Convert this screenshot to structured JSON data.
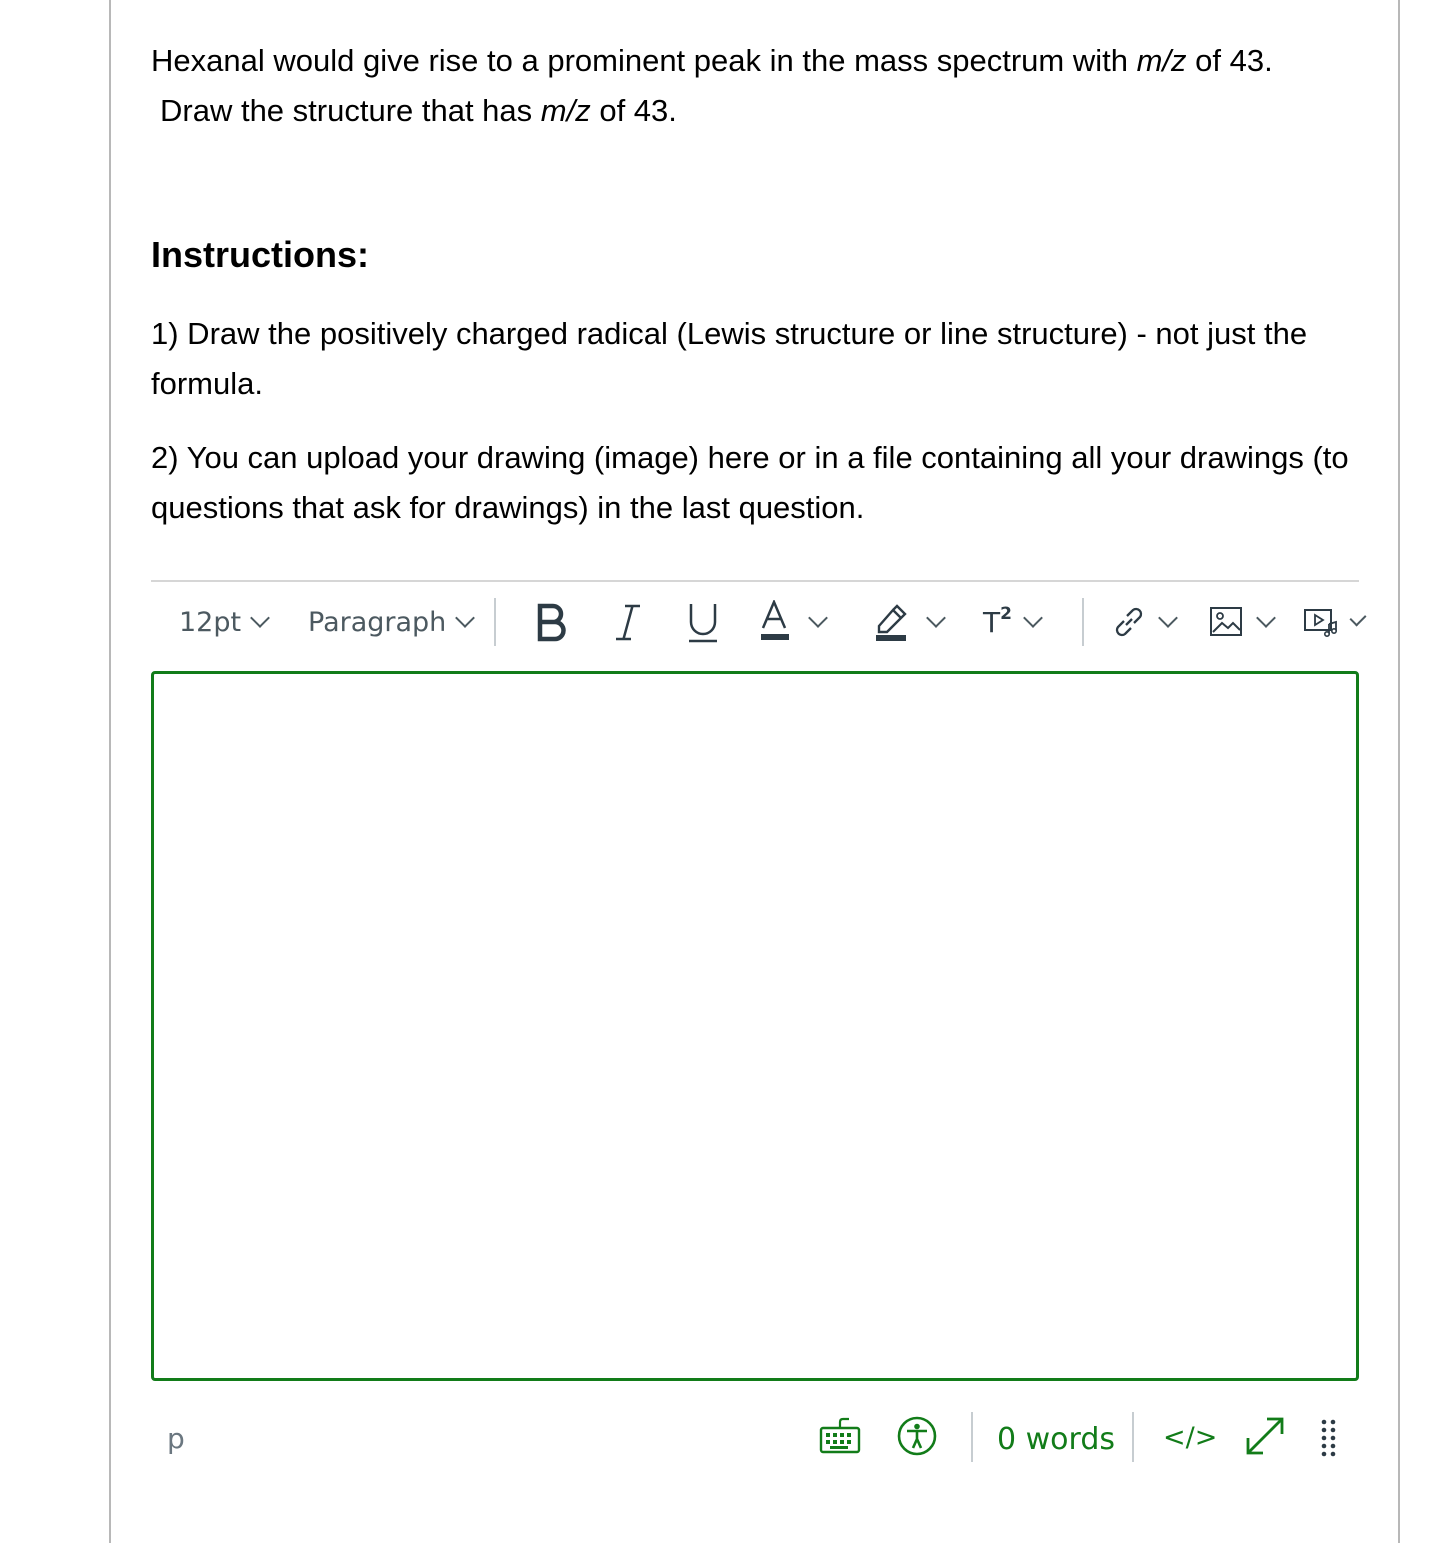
{
  "question": {
    "line1_prefix": "Hexanal would give rise to a prominent peak in the mass spectrum with ",
    "mz": "m/z",
    "line1_suffix": " of 43.",
    "line2_prefix": "Draw the structure that has ",
    "line2_suffix": " of 43."
  },
  "instructions": {
    "title": "Instructions:",
    "item1": "1)  Draw the positively charged radical (Lewis structure or line structure) - not just the formula.",
    "item2": "2)  You can upload your drawing (image) here or in a file containing all your drawings (to questions that ask for drawings) in the last question."
  },
  "toolbar": {
    "font_size": "12pt",
    "block_format": "Paragraph",
    "superscript_label": "T",
    "superscript_exp": "2"
  },
  "status_bar": {
    "element_path": "p",
    "word_count": "0 words",
    "html_toggle": "</>"
  },
  "colors": {
    "accent": "#127c19",
    "toolbar_text": "#2d3b45",
    "border": "#b8b8b8"
  }
}
